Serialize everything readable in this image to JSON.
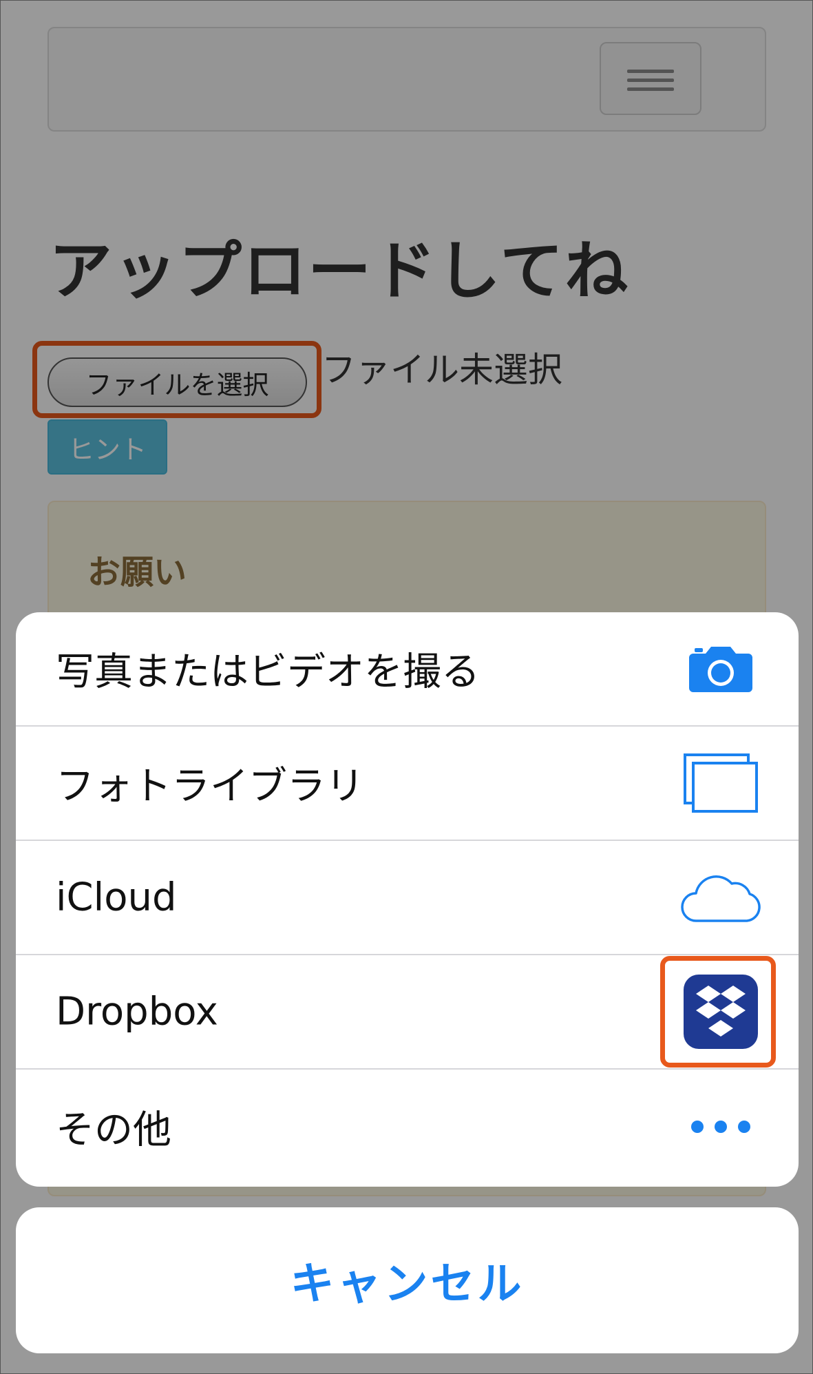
{
  "page": {
    "title": "アップロードしてね",
    "file_button_label": "ファイルを選択",
    "file_status": "ファイル未選択",
    "hint_label": "ヒント",
    "notice_title": "お願い"
  },
  "action_sheet": {
    "items": [
      {
        "label": "写真またはビデオを撮る",
        "icon": "camera-icon"
      },
      {
        "label": "フォトライブラリ",
        "icon": "photo-library-icon"
      },
      {
        "label": "iCloud",
        "icon": "icloud-icon"
      },
      {
        "label": "Dropbox",
        "icon": "dropbox-icon"
      },
      {
        "label": "その他",
        "icon": "more-icon"
      }
    ],
    "cancel_label": "キャンセル"
  },
  "colors": {
    "ios_blue": "#1a82f0",
    "dropbox_blue": "#1f3a93",
    "highlight_orange": "#e8591c",
    "hint_button": "#5bc0de"
  }
}
